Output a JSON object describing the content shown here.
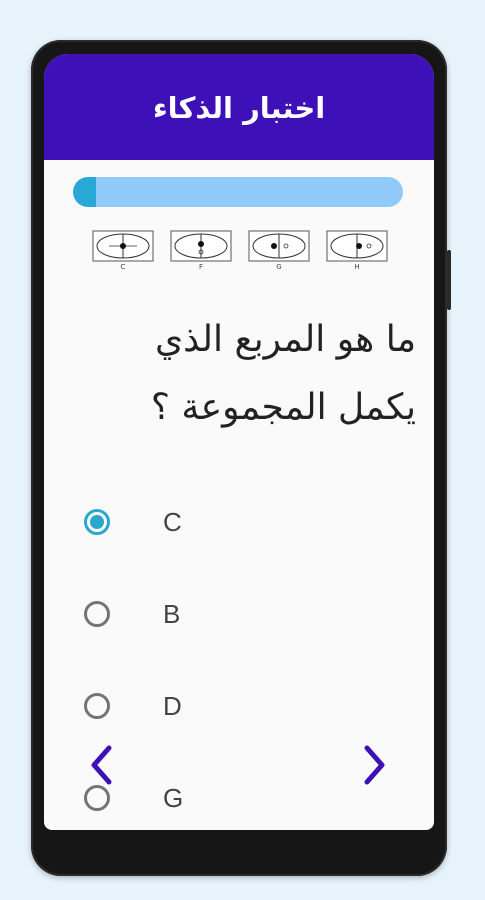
{
  "header": {
    "title": "اختبار الذكاء"
  },
  "progress": {
    "fraction": 0.07
  },
  "puzzle": {
    "tiles": [
      {
        "letter": "C"
      },
      {
        "letter": "F"
      },
      {
        "letter": "G"
      },
      {
        "letter": "H"
      }
    ]
  },
  "question": {
    "text": "ما هو المربع الذي يكمل المجموعة ؟"
  },
  "options": [
    {
      "label": "C",
      "selected": true
    },
    {
      "label": "B",
      "selected": false
    },
    {
      "label": "D",
      "selected": false
    },
    {
      "label": "G",
      "selected": false
    }
  ],
  "nav": {
    "prev_icon": "chevron-left-icon",
    "next_icon": "chevron-right-icon"
  },
  "colors": {
    "app_bar": "#3d10b8",
    "progress_track": "#90caf9",
    "progress_fill": "#29a8d6",
    "radio_selected": "#2aa7cf",
    "nav_arrow": "#3d10b8"
  }
}
